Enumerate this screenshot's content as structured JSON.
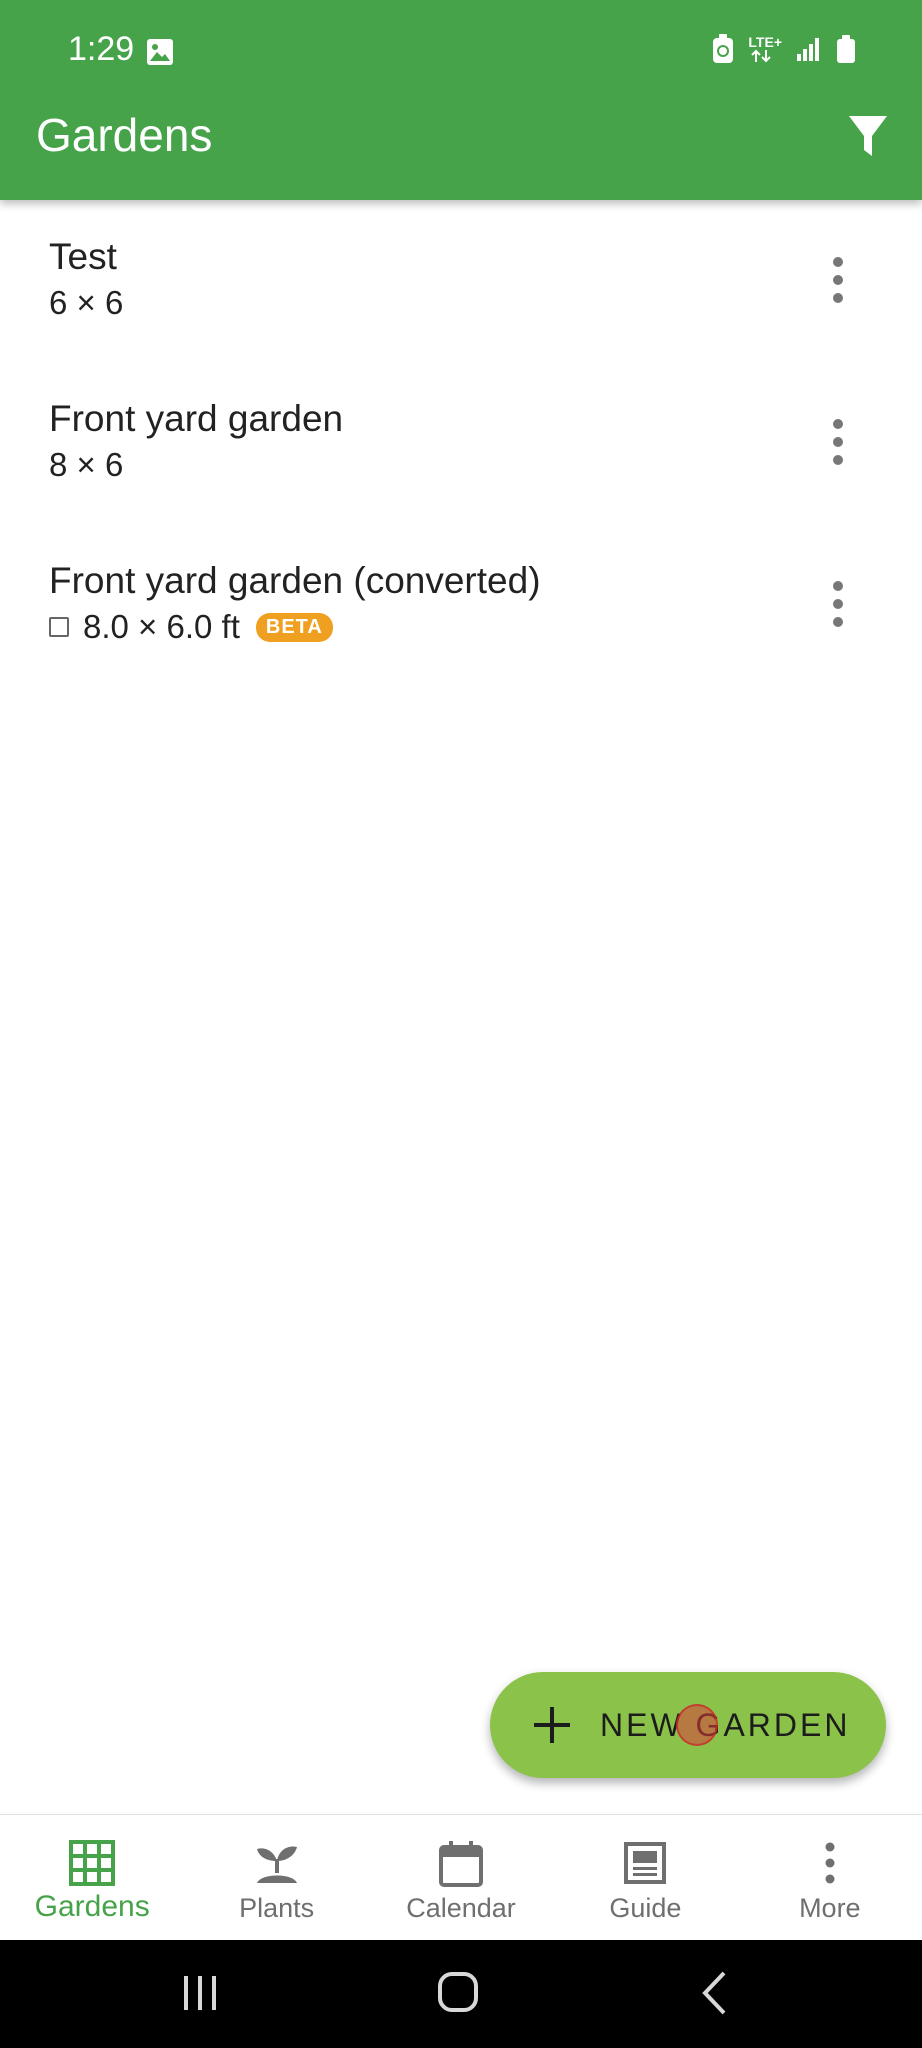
{
  "status_bar": {
    "time": "1:29",
    "network": "LTE+",
    "icons": [
      "gallery-icon",
      "battery-saver-icon",
      "signal-icon",
      "battery-icon"
    ]
  },
  "app_bar": {
    "title": "Gardens",
    "filter_icon": "filter-icon"
  },
  "gardens": [
    {
      "name": "Test",
      "size": "6 × 6",
      "beta": false,
      "square": false
    },
    {
      "name": "Front yard garden",
      "size": "8 × 6",
      "beta": false,
      "square": false
    },
    {
      "name": "Front yard garden (converted)",
      "size": "8.0 × 6.0 ft",
      "beta": true,
      "beta_label": "BETA",
      "square": true
    }
  ],
  "fab": {
    "label": "NEW GARDEN",
    "icon": "plus-icon"
  },
  "bottom_nav": {
    "items": [
      {
        "label": "Gardens",
        "icon": "grid-icon",
        "active": true
      },
      {
        "label": "Plants",
        "icon": "sprout-icon",
        "active": false
      },
      {
        "label": "Calendar",
        "icon": "calendar-icon",
        "active": false
      },
      {
        "label": "Guide",
        "icon": "guide-icon",
        "active": false
      },
      {
        "label": "More",
        "icon": "more-vert-icon",
        "active": false
      }
    ]
  },
  "colors": {
    "app_bar": "#46a34a",
    "fab": "#8bc34a",
    "beta_badge": "#f0a020",
    "active_nav": "#46a34a",
    "inactive_nav": "#6f6f6f"
  }
}
